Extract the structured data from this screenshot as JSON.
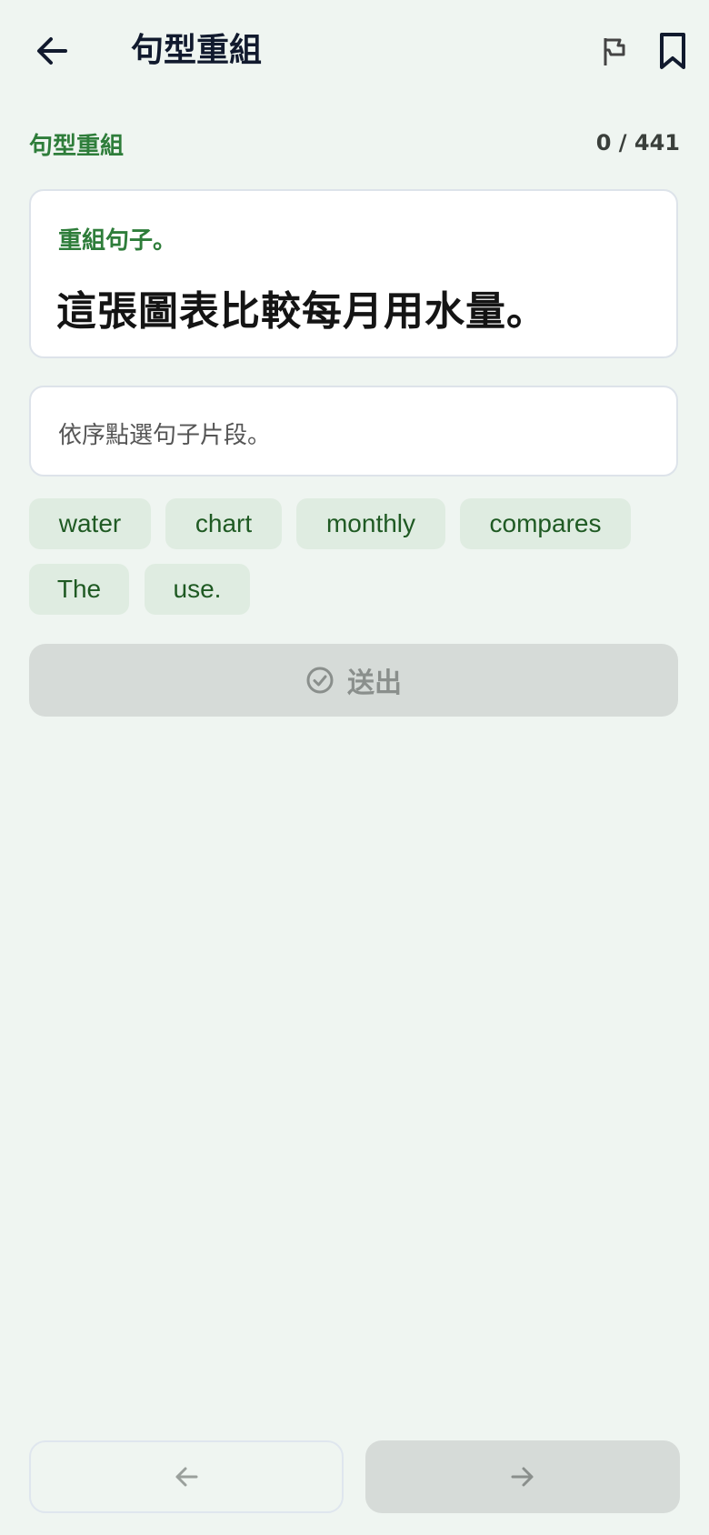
{
  "header": {
    "title": "句型重組",
    "back_icon": "arrow-left-icon",
    "report_icon": "flag-icon",
    "bookmark_icon": "bookmark-icon"
  },
  "exercise": {
    "section_label": "句型重組",
    "counter": "0 / 441",
    "instruction": "重組句子。",
    "sentence": "這張圖表比較每月用水量。",
    "answer_placeholder": "依序點選句子片段。",
    "word_chips": [
      "water",
      "chart",
      "monthly",
      "compares",
      "The",
      "use."
    ]
  },
  "actions": {
    "submit_label": "送出",
    "submit_icon": "check-circle-icon",
    "prev_icon": "arrow-left-icon",
    "next_icon": "arrow-right-icon"
  },
  "colors": {
    "accent_green": "#2e7d3a",
    "chip_bg": "#dfece1",
    "background": "#eff5f1"
  }
}
